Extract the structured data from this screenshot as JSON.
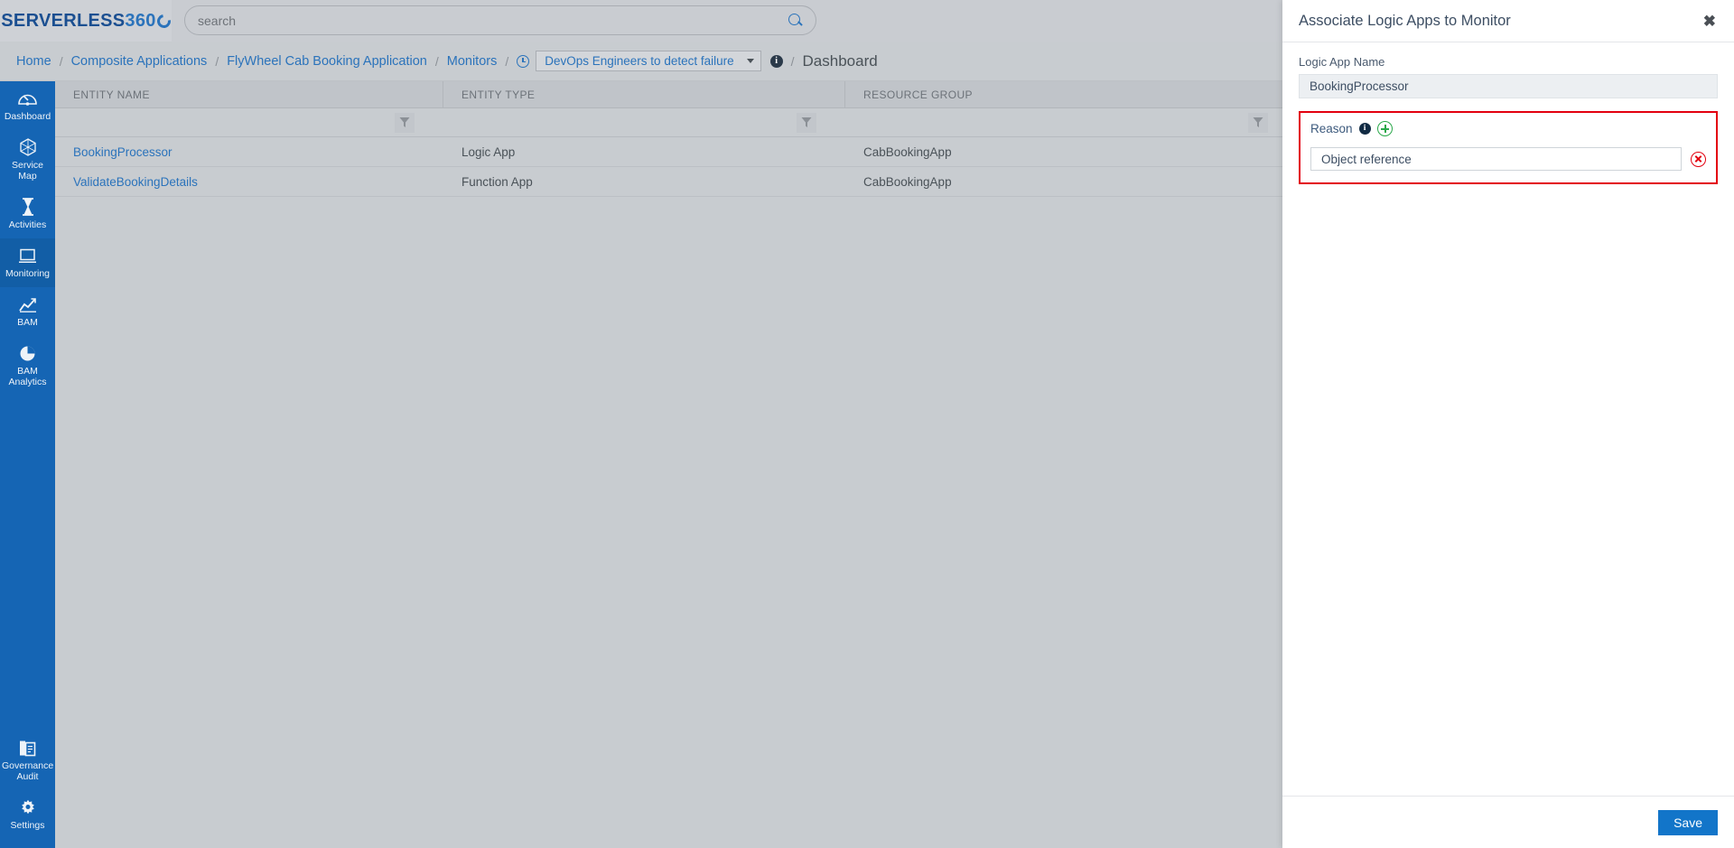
{
  "brand": {
    "word": "SERVERLESS",
    "number": "360"
  },
  "search": {
    "placeholder": "search",
    "icon": "search-icon"
  },
  "breadcrumb": {
    "items": [
      {
        "label": "Home",
        "type": "link"
      },
      {
        "label": "Composite Applications",
        "type": "link"
      },
      {
        "label": "FlyWheel Cab Booking Application",
        "type": "link"
      },
      {
        "label": "Monitors",
        "type": "link"
      }
    ],
    "separator": "/",
    "monitor_select": {
      "value": "DevOps Engineers to detect failure",
      "icon": "clock-icon"
    },
    "current": "Dashboard"
  },
  "sidebar": {
    "items": [
      {
        "label": "Dashboard",
        "icon": "dashboard-icon",
        "active": false
      },
      {
        "label": "Service Map",
        "icon": "service-map-icon",
        "active": false
      },
      {
        "label": "Activities",
        "icon": "hourglass-icon",
        "active": false
      },
      {
        "label": "Monitoring",
        "icon": "monitor-screen-icon",
        "active": true
      },
      {
        "label": "BAM",
        "icon": "line-chart-icon",
        "active": false
      },
      {
        "label": "BAM\nAnalytics",
        "icon": "pie-chart-icon",
        "active": false
      }
    ],
    "bottom_items": [
      {
        "label": "Governance\nAudit",
        "icon": "governance-audit-icon"
      },
      {
        "label": "Settings",
        "icon": "gear-icon"
      }
    ]
  },
  "table": {
    "columns": [
      "ENTITY NAME",
      "ENTITY TYPE",
      "RESOURCE GROUP",
      ""
    ],
    "filter_icon": "filter-funnel-icon",
    "rows": [
      {
        "entity_name": "BookingProcessor",
        "entity_type": "Logic App",
        "resource_group": "CabBookingApp",
        "extra": ""
      },
      {
        "entity_name": "ValidateBookingDetails",
        "entity_type": "Function App",
        "resource_group": "CabBookingApp",
        "extra": ""
      }
    ]
  },
  "panel": {
    "title": "Associate Logic Apps to Monitor",
    "close_icon": "close-icon",
    "logic_app_name": {
      "label": "Logic App Name",
      "value": "BookingProcessor"
    },
    "reason": {
      "label": "Reason",
      "info_icon": "info-icon",
      "add_icon": "plus-circle-icon",
      "entries": [
        {
          "value": "Object reference",
          "remove_icon": "remove-circle-icon"
        }
      ]
    },
    "save_label": "Save"
  },
  "colors": {
    "brand_blue": "#1565b4",
    "link_blue": "#2b73bb",
    "accent_red": "#e3000f",
    "accent_green": "#2aa84a",
    "save_blue": "#1275c9",
    "page_bg": "#c8ccd0"
  }
}
